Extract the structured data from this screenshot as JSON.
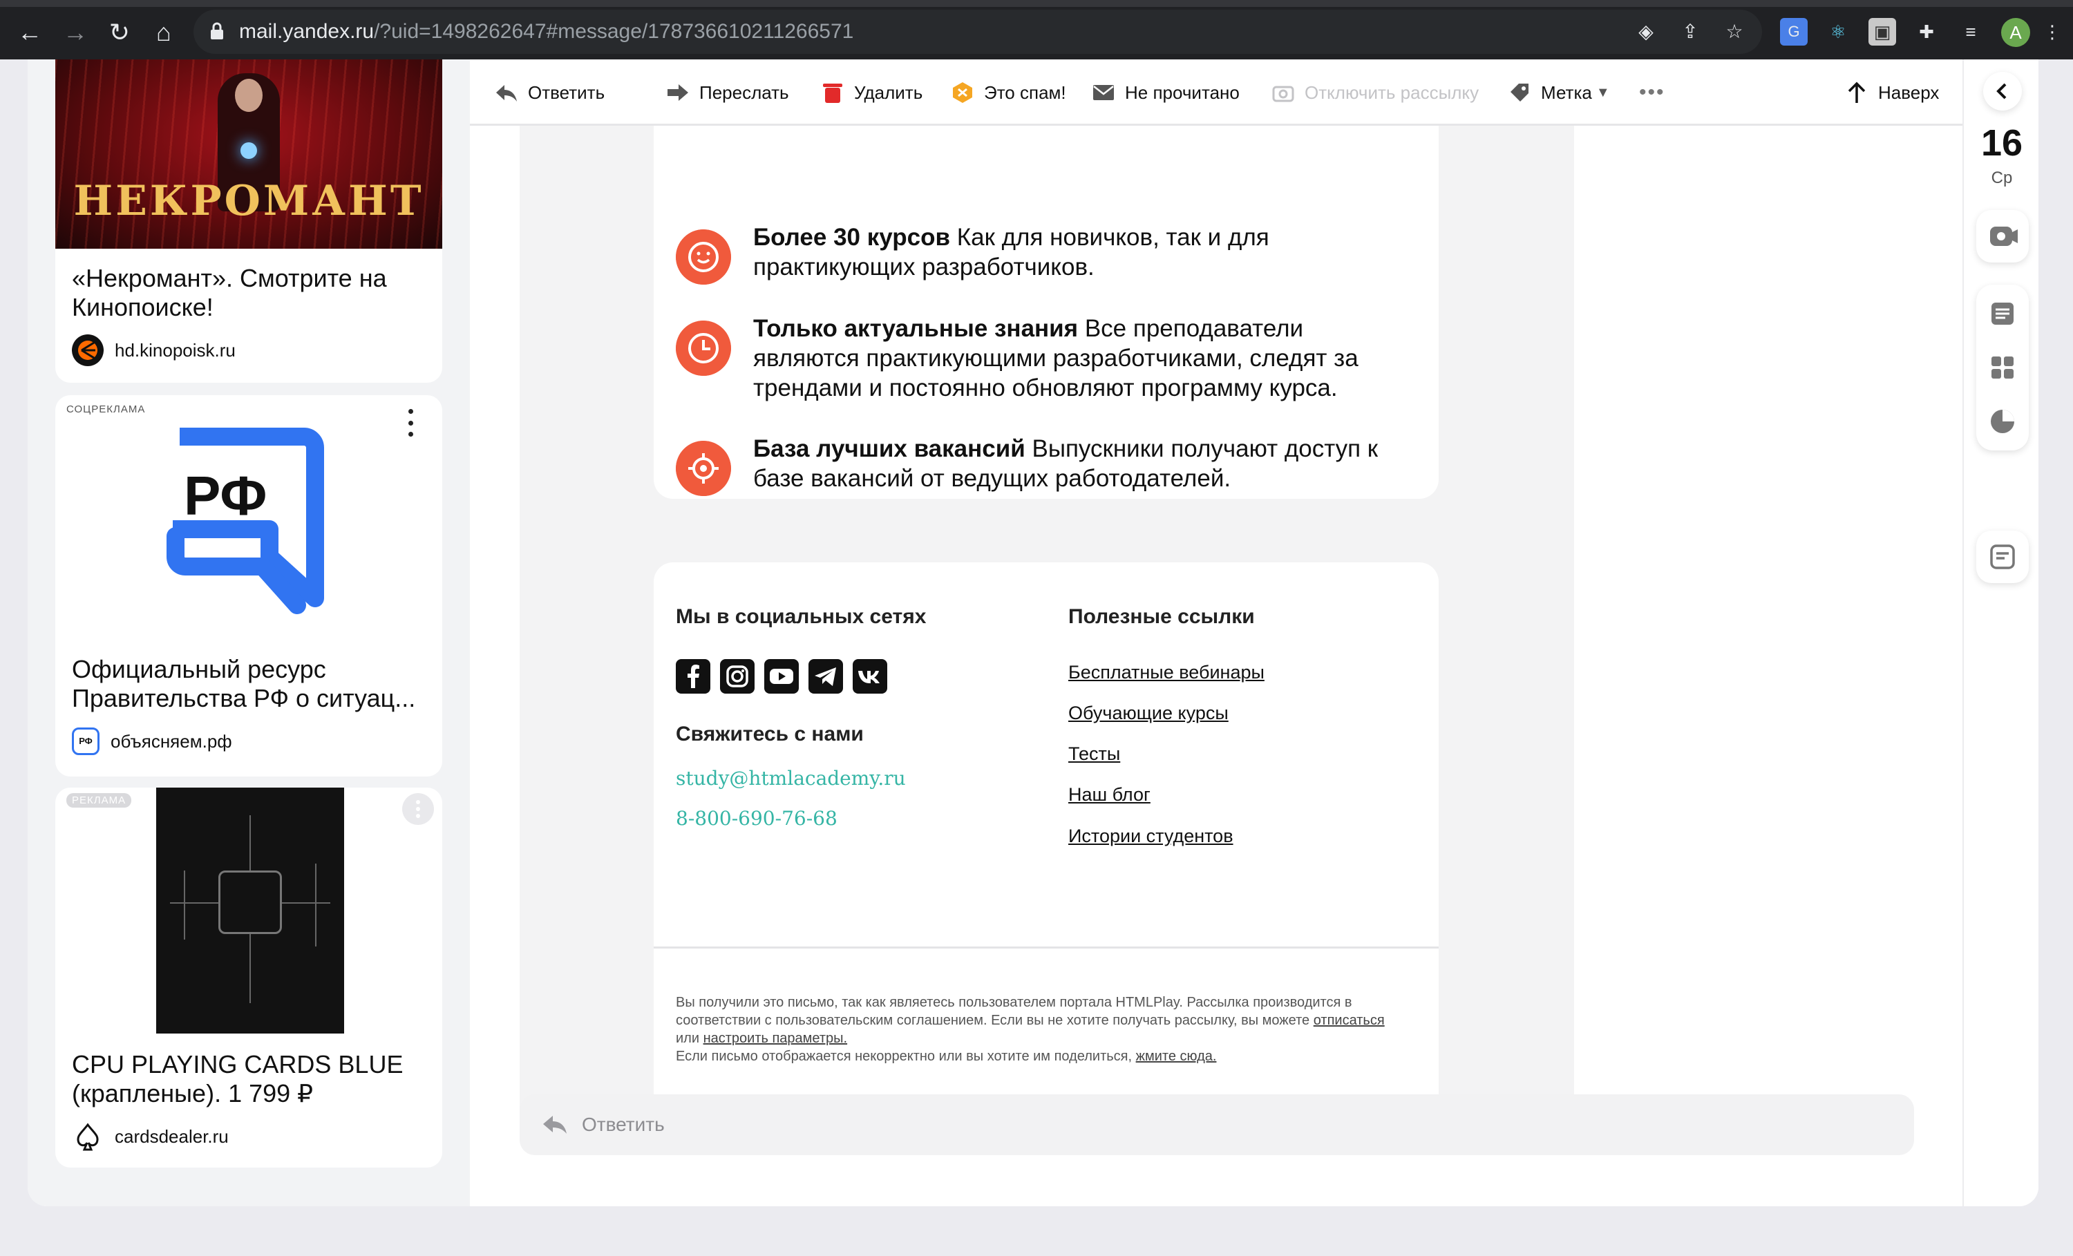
{
  "browser": {
    "url_host": "mail.yandex.ru",
    "url_path": "/?uid=1498262647#message/178736610211266571",
    "avatar_letter": "A"
  },
  "toolbar": {
    "reply": "Ответить",
    "forward": "Переслать",
    "delete": "Удалить",
    "spam": "Это спам!",
    "unread": "Не прочитано",
    "unsubscribe": "Отключить рассылку",
    "label": "Метка",
    "up": "Наверх"
  },
  "ads": [
    {
      "image_title": "НЕКРОМАНТ",
      "text": "«Некромант». Смотрите на Кинопоиске!",
      "source": "hd.kinopoisk.ru"
    },
    {
      "label": "СОЦРЕКЛАМА",
      "logo_text": "РФ",
      "text": "Официальный ресурс Правительства РФ о ситуац...",
      "source": "объясняем.рф",
      "source_badge": "РФ"
    },
    {
      "label": "РЕКЛАМА",
      "text": "CPU PLAYING CARDS BLUE (крапленые). 1 799 ₽",
      "source": "cardsdealer.ru"
    }
  ],
  "features": [
    {
      "bold": "Более 30 курсов",
      "text": " Как для новичков, так и для практикующих разработчиков."
    },
    {
      "bold": "Только актуальные знания",
      "text": " Все преподаватели являются практикующими разработчиками, следят за трендами и постоянно обновляют программу курса."
    },
    {
      "bold": "База лучших вакансий",
      "text": " Выпускники получают доступ к базе вакансий от ведущих работодателей."
    }
  ],
  "footer": {
    "social_heading": "Мы в социальных сетях",
    "contact_heading": "Свяжитесь с нами",
    "email": "study@htmlacademy.ru",
    "phone": "8-800-690-76-68",
    "links_heading": "Полезные ссылки",
    "links": [
      "Бесплатные вебинары",
      "Обучающие курсы",
      "Тесты",
      "Наш блог",
      "Истории студентов"
    ],
    "notice_1": "Вы получили это письмо, так как являетесь пользователем портала HTMLPlay. Рассылка производится в соответствии с пользовательским соглашением. Если вы не хотите получать рассылку, вы можете ",
    "unsubscribe_link": "отписаться",
    "or": " или ",
    "settings_link": "настроить параметры.",
    "notice_2": "Если письмо отображается некорректно или вы хотите им поделиться, ",
    "here_link": "жмите сюда."
  },
  "reply_bar": {
    "label": "Ответить"
  },
  "rail": {
    "date": "16",
    "weekday": "Ср"
  },
  "colors": {
    "accent": "#f05a3c",
    "link": "#35b5a5",
    "rf_blue": "#3174f1"
  }
}
